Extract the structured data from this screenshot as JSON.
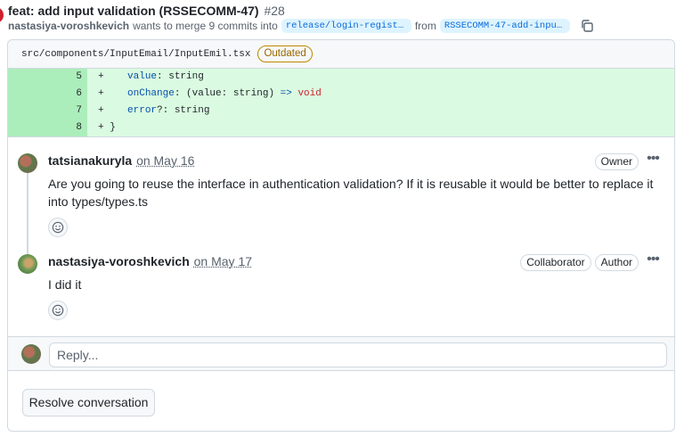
{
  "pr": {
    "title": "feat: add input validation (RSSECOMM-47)",
    "number": "#28",
    "author": "nastasiya-voroshkevich",
    "merge_text": "wants to merge 9 commits into",
    "base_branch": "release/login-registratio…",
    "from_text": "from",
    "head_branch": "RSSECOMM-47-add-input-val…",
    "state_color": "#cf222e"
  },
  "file": {
    "path": "src/components/InputEmail/InputEmil.tsx",
    "badge": "Outdated"
  },
  "diff": {
    "lines": [
      {
        "num": "5",
        "sign": "+",
        "indent": "  ",
        "prop": "value",
        "rest": ": string"
      },
      {
        "num": "6",
        "sign": "+",
        "indent": "  ",
        "prop": "onChange",
        "rest": ": (value: string) ",
        "arrow": "=>",
        "kw": " void"
      },
      {
        "num": "7",
        "sign": "+",
        "indent": "  ",
        "prop": "error",
        "rest": "?: string"
      },
      {
        "num": "8",
        "sign": "+",
        "indent": "",
        "prop": "",
        "rest": "}"
      }
    ]
  },
  "comments": [
    {
      "author": "tatsianakuryla",
      "date": "on May 16",
      "badges": [
        "Owner"
      ],
      "body": "Are you going to reuse the interface in authentication validation? If it is reusable it would be better to replace it into types/types.ts"
    },
    {
      "author": "nastasiya-voroshkevich",
      "date": "on May 17",
      "badges": [
        "Collaborator",
        "Author"
      ],
      "body": "I did it"
    }
  ],
  "reply": {
    "placeholder": "Reply..."
  },
  "resolve_label": "Resolve conversation",
  "icons": {
    "copy": "copy-icon",
    "kebab": "kebab-horizontal-icon",
    "reaction": "smiley-icon"
  }
}
